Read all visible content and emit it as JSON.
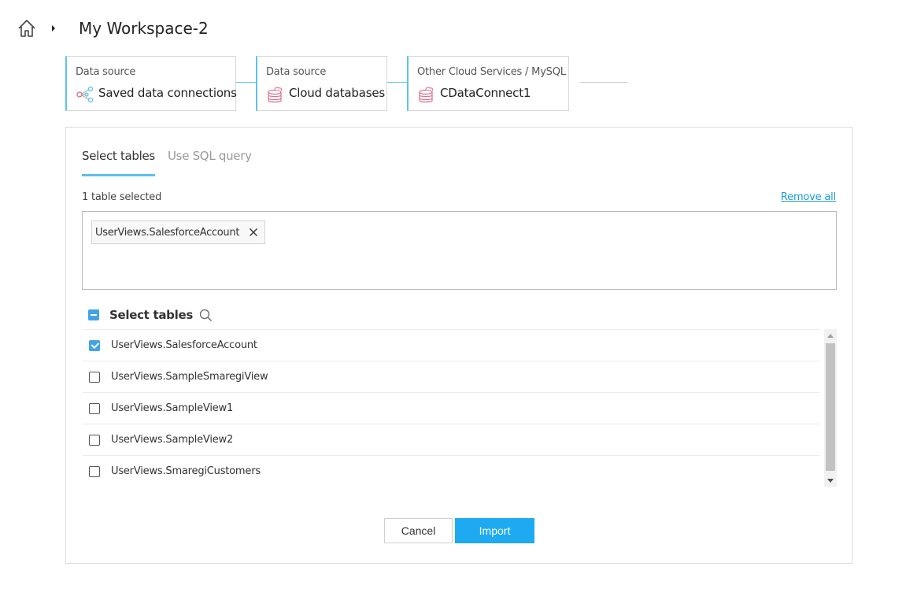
{
  "header": {
    "home_icon": "home-icon",
    "caret_icon": "caret-right-icon",
    "title": "My Workspace-2"
  },
  "steps": [
    {
      "caption": "Data source",
      "name": "Saved data connections",
      "icon": "share-nodes-icon"
    },
    {
      "caption": "Data source",
      "name": "Cloud databases",
      "icon": "cloud-database-icon"
    },
    {
      "caption": "Other Cloud Services / MySQL",
      "name": "CDataConnect1",
      "icon": "cloud-database-icon"
    }
  ],
  "tabs": [
    {
      "label": "Select tables",
      "active": true
    },
    {
      "label": "Use SQL query",
      "active": false
    }
  ],
  "selection": {
    "count_text": "1 table selected",
    "remove_all_label": "Remove all",
    "chips": [
      "UserViews.SalesforceAccount"
    ]
  },
  "table_list": {
    "header_label": "Select tables",
    "rows": [
      {
        "label": "UserViews.SalesforceAccount",
        "checked": true
      },
      {
        "label": "UserViews.SampleSmaregiView",
        "checked": false
      },
      {
        "label": "UserViews.SampleView1",
        "checked": false
      },
      {
        "label": "UserViews.SampleView2",
        "checked": false
      },
      {
        "label": "UserViews.SmaregiCustomers",
        "checked": false
      }
    ]
  },
  "buttons": {
    "cancel_label": "Cancel",
    "import_label": "Import"
  },
  "colors": {
    "accent": "#5bc2ee",
    "primary_button": "#1eaaf1",
    "checkbox": "#42a4e6",
    "link": "#1a9bd7",
    "cloud_icon": "#e06a8a"
  }
}
